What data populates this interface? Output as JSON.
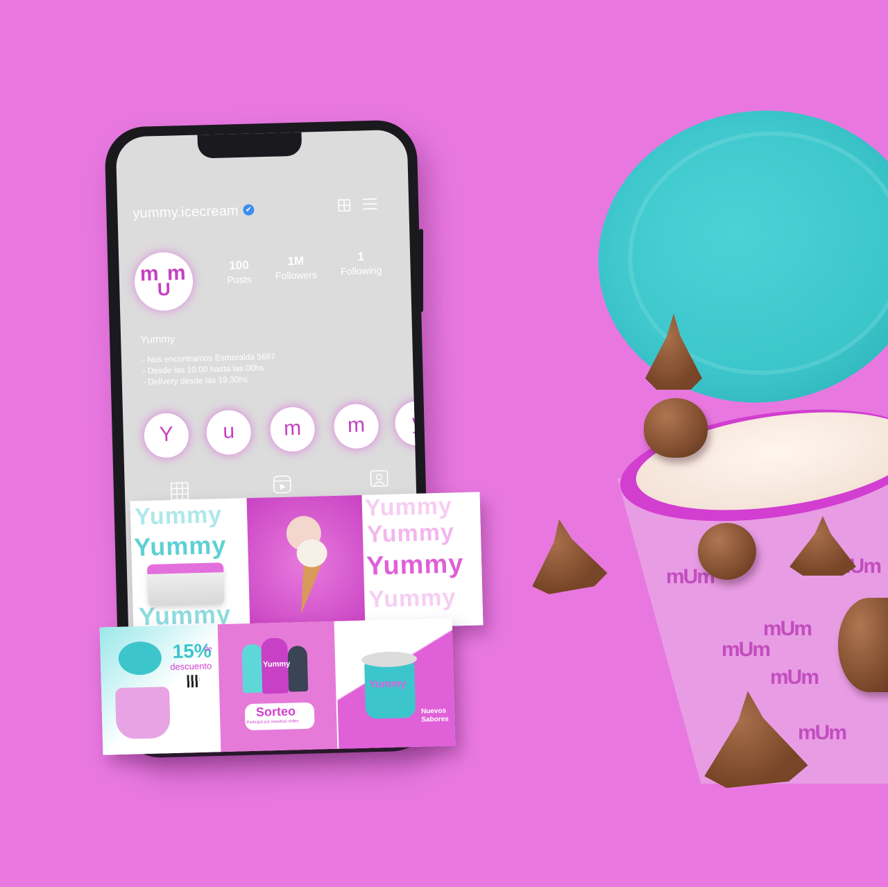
{
  "profile": {
    "username": "yummy.icecream",
    "verified_mark": "✔",
    "stats": [
      {
        "num": "100",
        "label": "Posts"
      },
      {
        "num": "1M",
        "label": "Followers"
      },
      {
        "num": "1",
        "label": "Following"
      }
    ],
    "display_name": "Yummy",
    "bio": [
      "- Nos encontramos Esmeralda 5687",
      "- Desde las 10.00 hasta las 00hs",
      "- Delivery desde las 19.30hs"
    ]
  },
  "avatar_logo": {
    "top": "m m",
    "bottom": "U"
  },
  "highlights": [
    "Y",
    "u",
    "m",
    "m",
    "y"
  ],
  "icons": {
    "grid_top": "grid-icon",
    "menu_top": "menu-icon",
    "tab_grid": "grid-icon",
    "tab_reels": "reels-icon",
    "tab_tagged": "tagged-icon"
  },
  "posts_row1": {
    "tile1_words": [
      "Yummy",
      "Yummy",
      "Yummy"
    ],
    "tile3_words": [
      "Yummy",
      "Yummy",
      "Yummy",
      "Yummy"
    ]
  },
  "posts_row2": {
    "discount_pct": "15%",
    "discount_de": "de",
    "discount_text": "descuento",
    "pop_label": "Yummy",
    "raffle_title": "Sorteo",
    "raffle_sub": "Participá por nuestras redes",
    "cup_brand": "Yummy",
    "new_flavors": [
      "Nuevos",
      "Sabores"
    ]
  },
  "cup_logo": "mUm",
  "colors": {
    "background": "#e878e0",
    "teal": "#3cc6cc",
    "magenta": "#d23ed0",
    "screen": "#dcdcdc"
  }
}
